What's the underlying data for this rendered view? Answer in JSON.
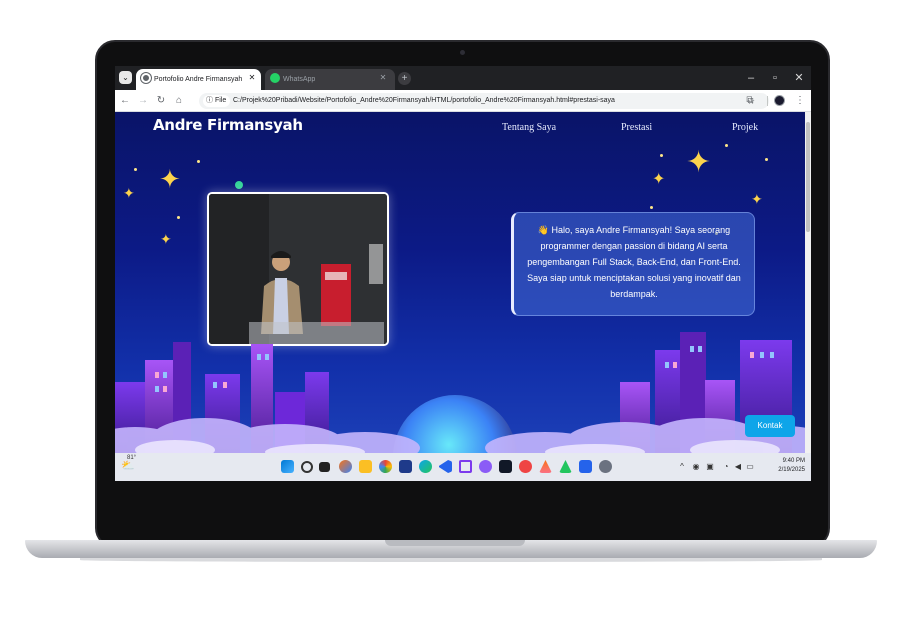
{
  "browser": {
    "tabs": [
      {
        "title": "Portofolio Andre Firmansyah",
        "favicon": "chrome-page-icon",
        "active": true
      },
      {
        "title": "WhatsApp",
        "favicon": "whatsapp-icon",
        "active": false
      }
    ],
    "file_chip": "File",
    "url": "C:/Projek%20Pribadi/Website/Portofolio_Andre%20Firmansyah/HTML/portofolio_Andre%20Firmansyah.html#prestasi-saya"
  },
  "site": {
    "brand": "Andre Firmansyah",
    "nav": [
      "Tentang Saya",
      "Prestasi",
      "Projek"
    ],
    "bio": "👋 Halo, saya Andre Firmansyah! Saya seorang programmer dengan passion di bidang AI serta pengembangan Full Stack, Back-End, dan Front-End. Saya siap untuk menciptakan solusi yang inovatif dan berdampak.",
    "contact_button": "Kontak",
    "colors": {
      "accent": "#0ea5e9",
      "star": "#fcd34d",
      "background": "#0c1a86"
    }
  },
  "taskbar": {
    "weather_temp": "81°",
    "time": "9:40 PM",
    "date": "2/19/2025"
  }
}
